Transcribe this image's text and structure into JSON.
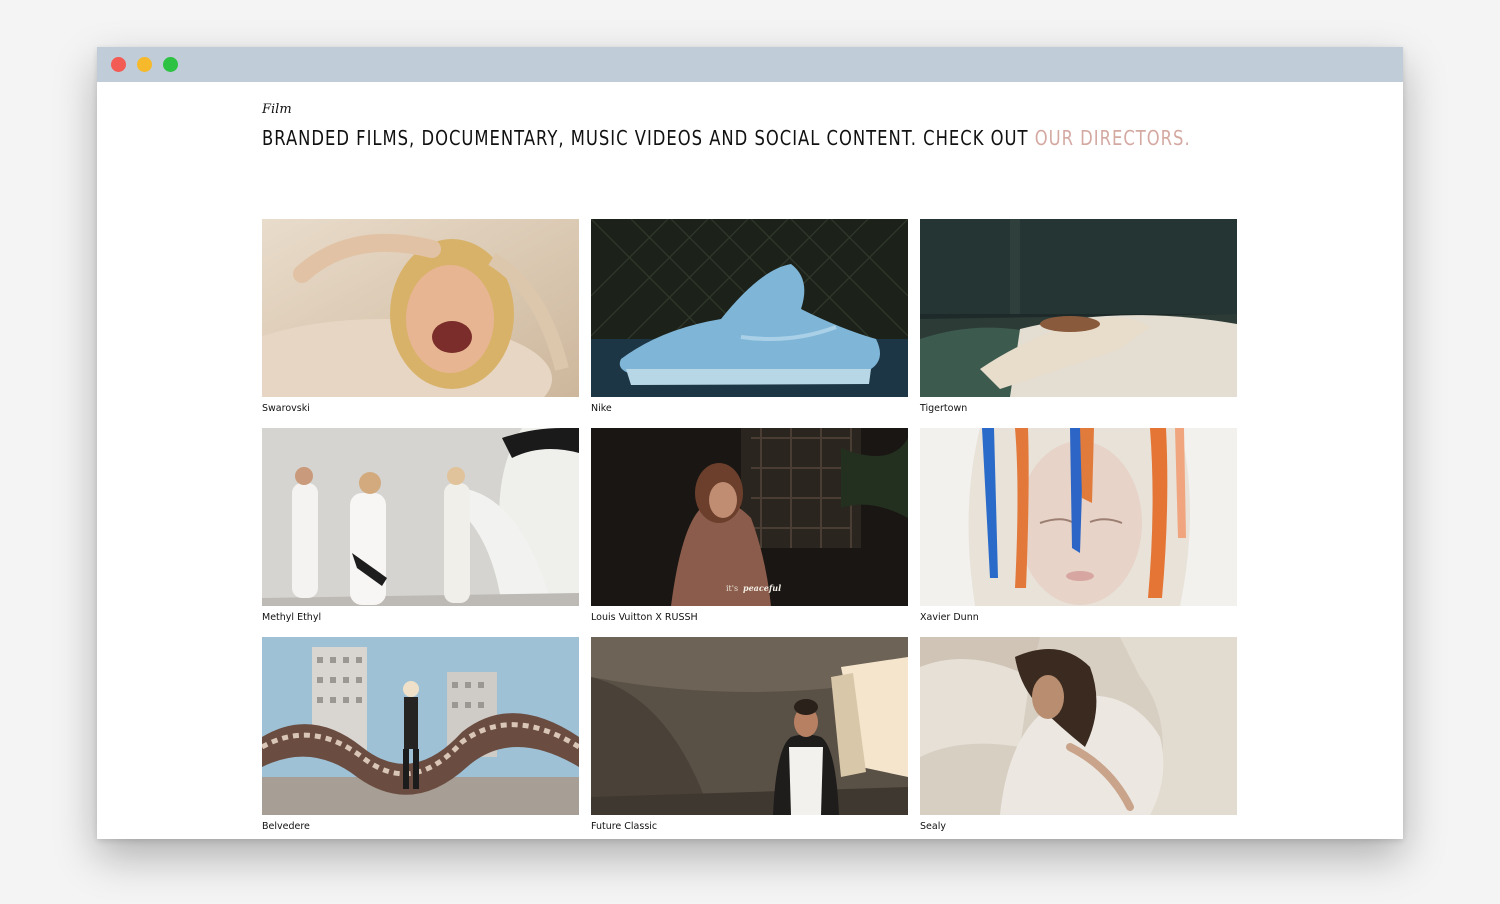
{
  "page": {
    "section_label": "Film",
    "headline_text": "BRANDED FILMS, DOCUMENTARY, MUSIC VIDEOS AND SOCIAL CONTENT. CHECK OUT ",
    "headline_link": "OUR DIRECTORS."
  },
  "colors": {
    "titlebar": "#c0ccd7",
    "link_accent": "#d4a9a2",
    "close": "#f35b55",
    "minimize": "#f6b92b",
    "maximize": "#2ec244"
  },
  "films": [
    {
      "title": "Swarovski"
    },
    {
      "title": "Nike"
    },
    {
      "title": "Tigertown"
    },
    {
      "title": "Methyl Ethyl"
    },
    {
      "title": "Louis Vuitton X RUSSH",
      "overlay_text_1": "it's",
      "overlay_text_2": "peaceful"
    },
    {
      "title": "Xavier Dunn"
    },
    {
      "title": "Belvedere"
    },
    {
      "title": "Future Classic"
    },
    {
      "title": "Sealy"
    }
  ]
}
